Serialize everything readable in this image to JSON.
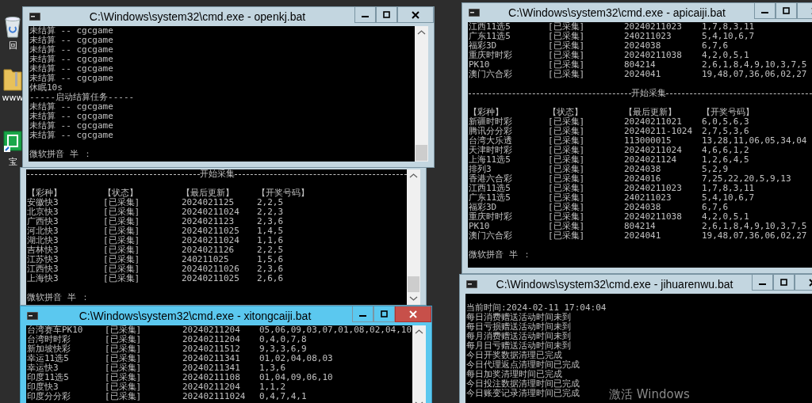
{
  "desktop": {
    "icons": [
      {
        "label": "回"
      },
      {
        "label": "www"
      },
      {
        "label": "宝"
      }
    ],
    "notice": "激活 Windows"
  },
  "windows": [
    {
      "title": "C:\\Windows\\system32\\cmd.exe - openkj.bat",
      "active": false,
      "lines": [
        {
          "kind": "text",
          "text": "未结算 -- cgcgame"
        },
        {
          "kind": "text",
          "text": "未结算 -- cgcgame"
        },
        {
          "kind": "text",
          "text": "未结算 -- cgcgame"
        },
        {
          "kind": "text",
          "text": "未结算 -- cgcgame"
        },
        {
          "kind": "text",
          "text": "未结算 -- cgcgame"
        },
        {
          "kind": "text",
          "text": "未结算 -- cgcgame"
        },
        {
          "kind": "text",
          "text": "休眠10s"
        },
        {
          "kind": "text",
          "text": "-----启动结算任务-----"
        },
        {
          "kind": "text",
          "text": "未结算 -- cgcgame"
        },
        {
          "kind": "text",
          "text": "未结算 -- cgcgame"
        },
        {
          "kind": "text",
          "text": "未结算 -- cgcgame"
        },
        {
          "kind": "text",
          "text": "未结算 -- cgcgame"
        },
        {
          "kind": "blank"
        },
        {
          "kind": "text",
          "text": "微软拼音 半 ："
        }
      ]
    },
    {
      "active": false,
      "lines": [
        {
          "kind": "divider",
          "text": "开始采集"
        },
        {
          "kind": "blank"
        },
        {
          "kind": "row",
          "cells": [
            "【彩种】",
            "【状态】",
            "【最后更新】",
            "【开奖号码】"
          ]
        },
        {
          "kind": "row",
          "cells": [
            "安徽快3",
            "[已采集]",
            "2024021125",
            "2,2,5"
          ]
        },
        {
          "kind": "row",
          "cells": [
            "北京快3",
            "[已采集]",
            "20240211024",
            "2,2,3"
          ]
        },
        {
          "kind": "row",
          "cells": [
            "广西快3",
            "[已采集]",
            "2024021123",
            "2,3,6"
          ]
        },
        {
          "kind": "row",
          "cells": [
            "河北快3",
            "[已采集]",
            "20240211025",
            "1,4,5"
          ]
        },
        {
          "kind": "row",
          "cells": [
            "湖北快3",
            "[已采集]",
            "20240211024",
            "1,1,6"
          ]
        },
        {
          "kind": "row",
          "cells": [
            "吉林快3",
            "[已采集]",
            "2024021126",
            "2,2,5"
          ]
        },
        {
          "kind": "row",
          "cells": [
            "江苏快3",
            "[已采集]",
            "240211025",
            "1,5,6"
          ]
        },
        {
          "kind": "row",
          "cells": [
            "江西快3",
            "[已采集]",
            "20240211026",
            "2,3,6"
          ]
        },
        {
          "kind": "row",
          "cells": [
            "上海快3",
            "[已采集]",
            "20240211025",
            "2,6,6"
          ]
        },
        {
          "kind": "blank"
        },
        {
          "kind": "text",
          "text": "微软拼音 半 ："
        }
      ]
    },
    {
      "title": "C:\\Windows\\system32\\cmd.exe - xitongcaiji.bat",
      "active": true,
      "lines": [
        {
          "kind": "row",
          "cells": [
            "台湾赛车PK10",
            "[已采集]",
            "20240211204",
            "05,06,09,03,07,01,08,02,04,10"
          ]
        },
        {
          "kind": "row",
          "cells": [
            "台湾时时彩",
            "[已采集]",
            "20240211204",
            "0,4,0,7,8"
          ]
        },
        {
          "kind": "row",
          "cells": [
            "新加坡快彩",
            "[已采集]",
            "20240211512",
            "9,3,3,6,9"
          ]
        },
        {
          "kind": "row",
          "cells": [
            "幸运11选5",
            "[已采集]",
            "20240211341",
            "01,02,04,08,03"
          ]
        },
        {
          "kind": "row",
          "cells": [
            "幸运快3",
            "[已采集]",
            "20240211341",
            "1,3,6"
          ]
        },
        {
          "kind": "row",
          "cells": [
            "印度11选5",
            "[已采集]",
            "20240211108",
            "01,04,09,06,10"
          ]
        },
        {
          "kind": "row",
          "cells": [
            "印度快3",
            "[已采集]",
            "20240211204",
            "1,1,2"
          ]
        },
        {
          "kind": "row",
          "cells": [
            "印度分分彩",
            "[已采集]",
            "202402111024",
            "0,4,7,4,1"
          ]
        }
      ]
    },
    {
      "title": "C:\\Windows\\system32\\cmd.exe - apicaiji.bat",
      "active": false,
      "lines": [
        {
          "kind": "row",
          "cells": [
            "江西11选5",
            "[已采集]",
            "20240211023",
            "1,7,8,3,11"
          ]
        },
        {
          "kind": "row",
          "cells": [
            "广东11选5",
            "[已采集]",
            "240211023",
            "5,4,10,6,7"
          ]
        },
        {
          "kind": "row",
          "cells": [
            "福彩3D",
            "[已采集]",
            "2024038",
            "6,7,6"
          ]
        },
        {
          "kind": "row",
          "cells": [
            "重庆时时彩",
            "[已采集]",
            "20240211038",
            "4,2,0,5,1"
          ]
        },
        {
          "kind": "row",
          "cells": [
            "PK10",
            "[已采集]",
            "804214",
            "2,6,1,8,4,9,10,3,7,5"
          ]
        },
        {
          "kind": "row",
          "cells": [
            "澳门六合彩",
            "[已采集]",
            "2024041",
            "19,48,07,36,06,02,27"
          ]
        },
        {
          "kind": "blank"
        },
        {
          "kind": "divider",
          "text": "开始采集"
        },
        {
          "kind": "blank"
        },
        {
          "kind": "row",
          "cells": [
            "【彩种】",
            "【状态】",
            "【最后更新】",
            "【开奖号码】"
          ]
        },
        {
          "kind": "row",
          "cells": [
            "新疆时时彩",
            "[已采集]",
            "20240211021",
            "6,0,5,6,3"
          ]
        },
        {
          "kind": "row",
          "cells": [
            "腾讯分分彩",
            "[已采集]",
            "20240211-1024",
            "2,7,5,3,6"
          ]
        },
        {
          "kind": "row",
          "cells": [
            "台湾大乐透",
            "[已采集]",
            "113000015",
            "13,28,11,06,05,34,04"
          ]
        },
        {
          "kind": "row",
          "cells": [
            "天津时时彩",
            "[已采集]",
            "20240211024",
            "4,6,6,1,2"
          ]
        },
        {
          "kind": "row",
          "cells": [
            "上海11选5",
            "[已采集]",
            "2024021124",
            "1,2,6,4,5"
          ]
        },
        {
          "kind": "row",
          "cells": [
            "排列3",
            "[已采集]",
            "2024038",
            "5,2,9"
          ]
        },
        {
          "kind": "row",
          "cells": [
            "香港六合彩",
            "[已采集]",
            "2024016",
            "7,25,22,20,5,9,13"
          ]
        },
        {
          "kind": "row",
          "cells": [
            "江西11选5",
            "[已采集]",
            "20240211023",
            "1,7,8,3,11"
          ]
        },
        {
          "kind": "row",
          "cells": [
            "广东11选5",
            "[已采集]",
            "240211023",
            "5,4,10,6,7"
          ]
        },
        {
          "kind": "row",
          "cells": [
            "福彩3D",
            "[已采集]",
            "2024038",
            "6,7,6"
          ]
        },
        {
          "kind": "row",
          "cells": [
            "重庆时时彩",
            "[已采集]",
            "20240211038",
            "4,2,0,5,1"
          ]
        },
        {
          "kind": "row",
          "cells": [
            "PK10",
            "[已采集]",
            "804214",
            "2,6,1,8,4,9,10,3,7,5"
          ]
        },
        {
          "kind": "row",
          "cells": [
            "澳门六合彩",
            "[已采集]",
            "2024041",
            "19,48,07,36,06,02,27"
          ]
        },
        {
          "kind": "blank"
        },
        {
          "kind": "text",
          "text": "微软拼音 半 ："
        }
      ]
    },
    {
      "title": "C:\\Windows\\system32\\cmd.exe - jihuarenwu.bat",
      "active": false,
      "lines": [
        {
          "kind": "blank"
        },
        {
          "kind": "text",
          "text": "当前时间:2024-02-11 17:04:04"
        },
        {
          "kind": "text",
          "text": "每日消费赠送活动时间未到"
        },
        {
          "kind": "text",
          "text": "每日亏损赠送活动时间未到"
        },
        {
          "kind": "text",
          "text": "每月消费赠送活动时间未到"
        },
        {
          "kind": "text",
          "text": "每月日亏赠送活动时间未到"
        },
        {
          "kind": "text",
          "text": "今日开奖数据清理已完成"
        },
        {
          "kind": "text",
          "text": "今日代理返点清理时间已完成"
        },
        {
          "kind": "text",
          "text": "每日加奖清理时间已完成"
        },
        {
          "kind": "text",
          "text": "今日投注数据清理时间已完成"
        },
        {
          "kind": "text",
          "text": "今日账变记录清理时间已完成"
        }
      ]
    }
  ]
}
